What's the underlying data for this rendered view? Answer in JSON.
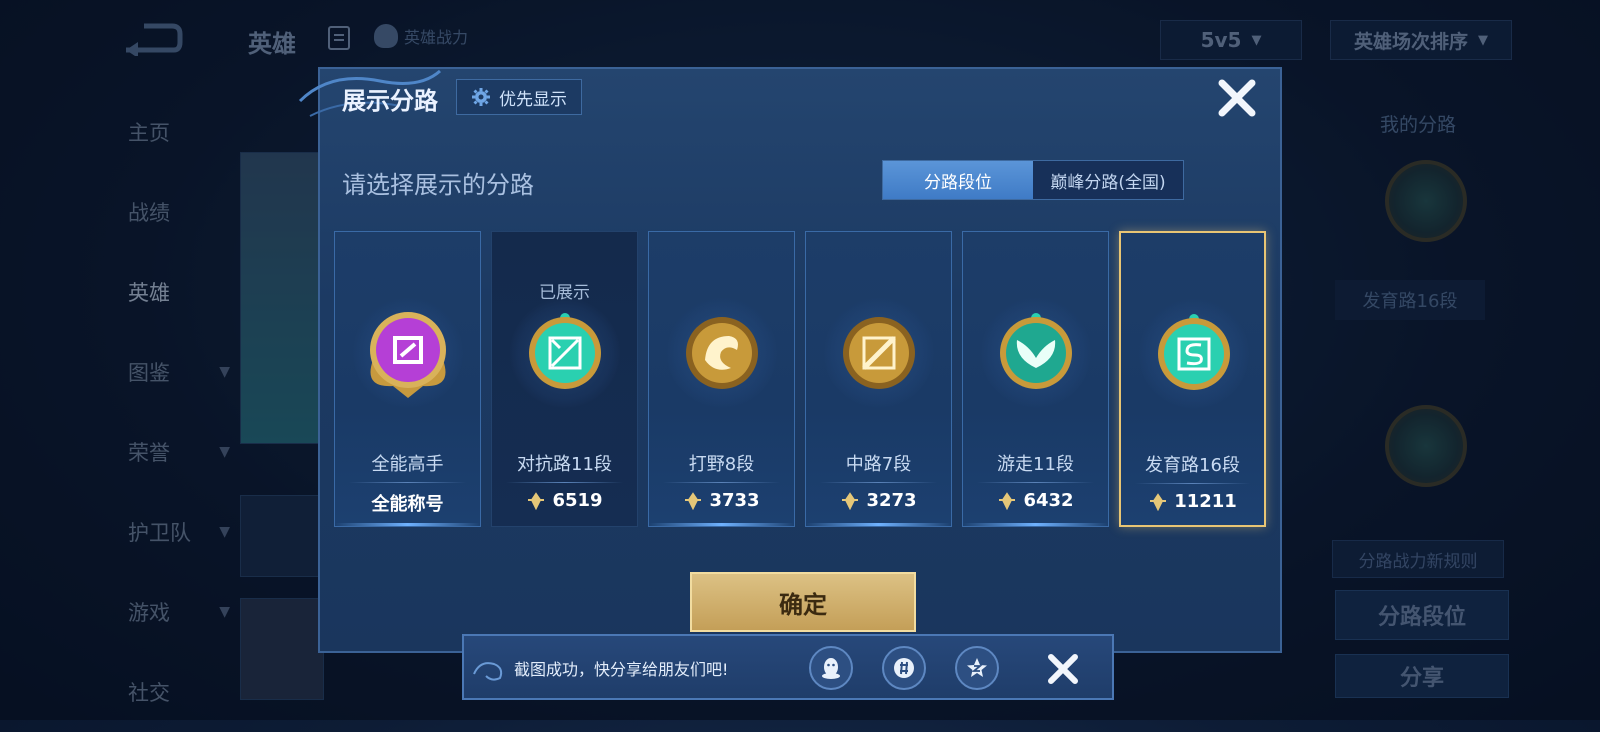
{
  "background": {
    "title": "英雄",
    "hero_power": "英雄战力",
    "mode": "5v5",
    "sort": "英雄场次排序",
    "nav": [
      {
        "label": "主页",
        "chevron": false
      },
      {
        "label": "战绩",
        "chevron": false
      },
      {
        "label": "英雄",
        "chevron": false,
        "active": true
      },
      {
        "label": "图鉴",
        "chevron": true
      },
      {
        "label": "荣誉",
        "chevron": true
      },
      {
        "label": "护卫队",
        "chevron": true
      },
      {
        "label": "游戏",
        "chevron": true
      },
      {
        "label": "社交",
        "chevron": false
      }
    ],
    "right": {
      "my_lane_title": "我的分路",
      "lane_label": "发育路16段",
      "rule_btn": "分路战力新规则",
      "lane_rank_btn": "分路段位",
      "share_btn": "分享"
    }
  },
  "modal": {
    "title": "展示分路",
    "priority_btn": "优先显示",
    "subtitle": "请选择展示的分路",
    "tabs": [
      {
        "label": "分路段位",
        "active": true
      },
      {
        "label": "巅峰分路(全国)",
        "active": false
      }
    ],
    "lanes": [
      {
        "name": "全能高手",
        "value": "全能称号",
        "shown": "",
        "icon": "allround-badge-icon",
        "show_power": false,
        "style": "normal",
        "color": "#b53fd6"
      },
      {
        "name": "对抗路11段",
        "value": "6519",
        "shown": "已展示",
        "icon": "clash-lane-badge-icon",
        "show_power": true,
        "style": "dark",
        "color": "#2ad0b0"
      },
      {
        "name": "打野8段",
        "value": "3733",
        "shown": "",
        "icon": "jungle-dragon-badge-icon",
        "show_power": true,
        "style": "normal",
        "color": "#c89a3a"
      },
      {
        "name": "中路7段",
        "value": "3273",
        "shown": "",
        "icon": "mid-lane-badge-icon",
        "show_power": true,
        "style": "normal",
        "color": "#c89a3a"
      },
      {
        "name": "游走11段",
        "value": "6432",
        "shown": "",
        "icon": "roam-wings-badge-icon",
        "show_power": true,
        "style": "normal",
        "color": "#2ad0b0"
      },
      {
        "name": "发育路16段",
        "value": "11211",
        "shown": "",
        "icon": "farm-lane-badge-icon",
        "show_power": true,
        "style": "selected",
        "color": "#2ad0b0"
      }
    ],
    "confirm": "确定"
  },
  "toast": {
    "text": "截图成功，快分享给朋友们吧!",
    "icons": [
      "qq-icon",
      "wechat-moments-icon",
      "qzone-icon"
    ]
  }
}
